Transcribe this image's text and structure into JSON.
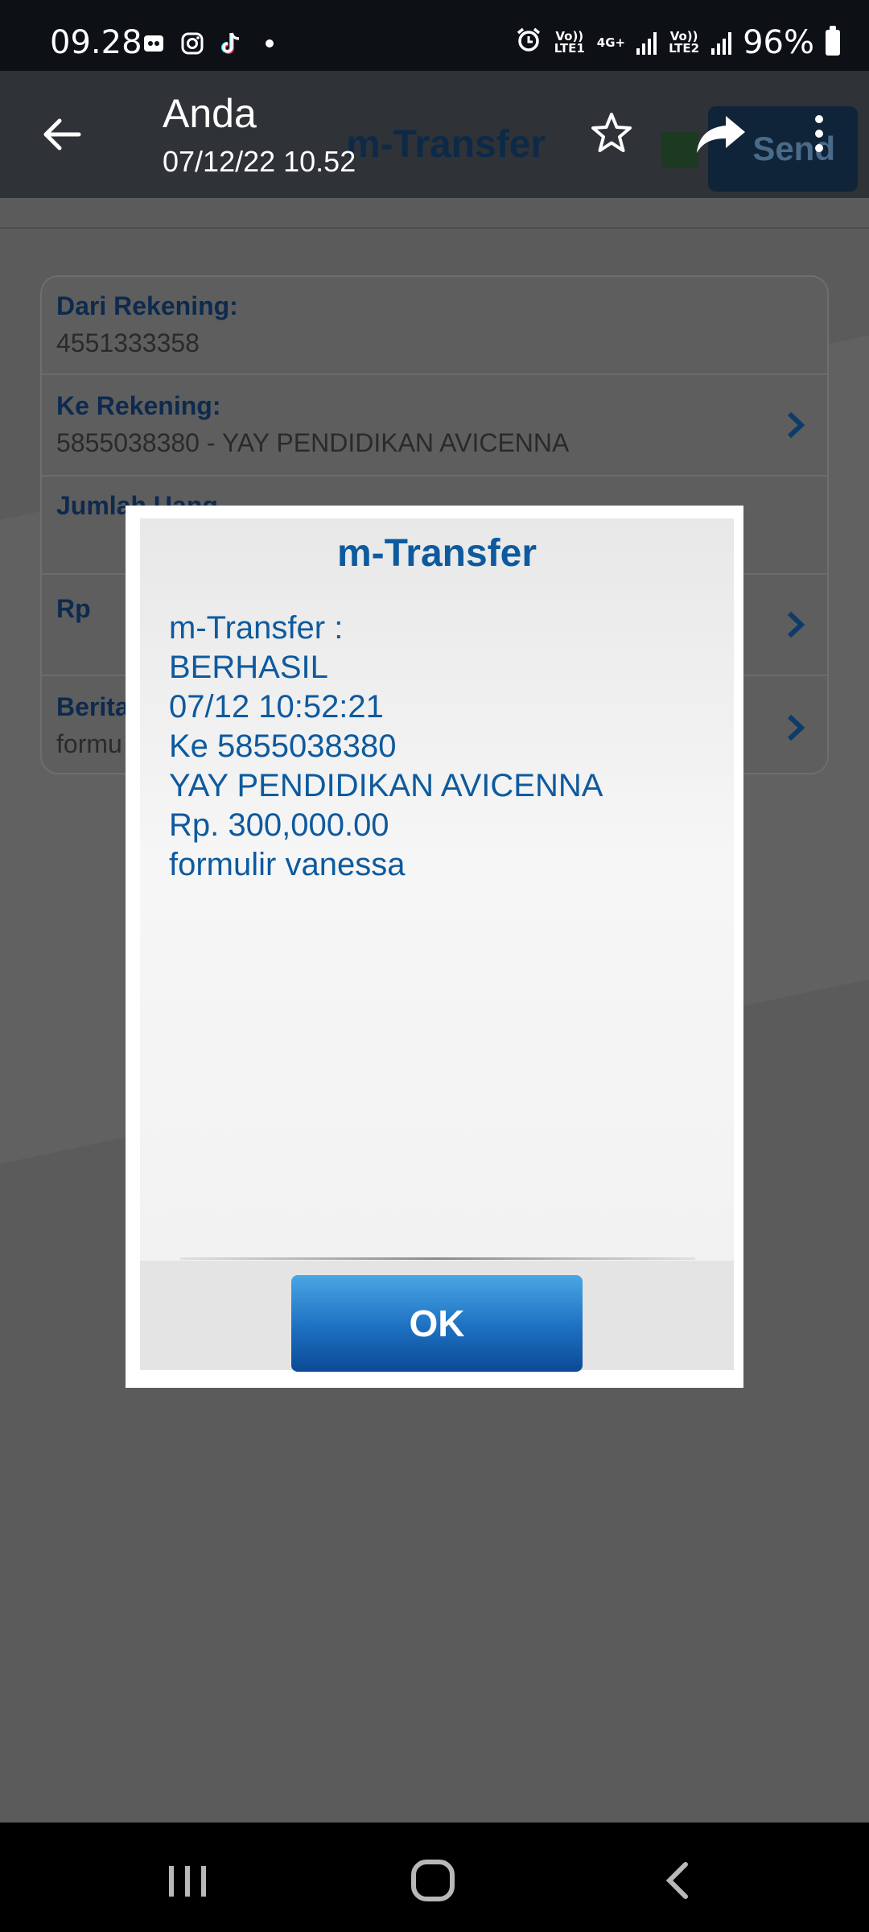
{
  "status_bar": {
    "time": "09.28",
    "network_label_1": "Vo)) LTE1",
    "network_type": "4G+",
    "network_label_2": "Vo)) LTE2",
    "battery": "96%"
  },
  "app_bar": {
    "title": "Anda",
    "subtitle": "07/12/22 10.52",
    "background_screen_title": "m-Transfer",
    "background_send_label": "Send"
  },
  "form": {
    "rows": [
      {
        "label": "Dari Rekening:",
        "value": "4551333358"
      },
      {
        "label": "Ke Rekening:",
        "value": "5855038380 - YAY PENDIDIKAN AVICENNA"
      },
      {
        "label": "Jumlah Uang",
        "value": ""
      },
      {
        "label": "Rp",
        "value": ""
      },
      {
        "label": "Berita",
        "value": "formu"
      }
    ]
  },
  "dialog": {
    "title": "m-Transfer",
    "lines": [
      "m-Transfer :",
      "BERHASIL",
      "07/12 10:52:21",
      "Ke 5855038380",
      "YAY PENDIDIKAN AVICENNA",
      "Rp. 300,000.00",
      "formulir vanessa"
    ],
    "ok_label": "OK"
  },
  "icons": [
    "back-arrow-icon",
    "star-icon",
    "share-icon",
    "more-vert-icon",
    "chevron-right-icon",
    "recent-apps-icon",
    "home-icon",
    "nav-back-icon"
  ],
  "colors": {
    "dialog_text": "#0e5a9e",
    "ok_button": "#1d6fc0",
    "app_bar": "#2f3236"
  }
}
